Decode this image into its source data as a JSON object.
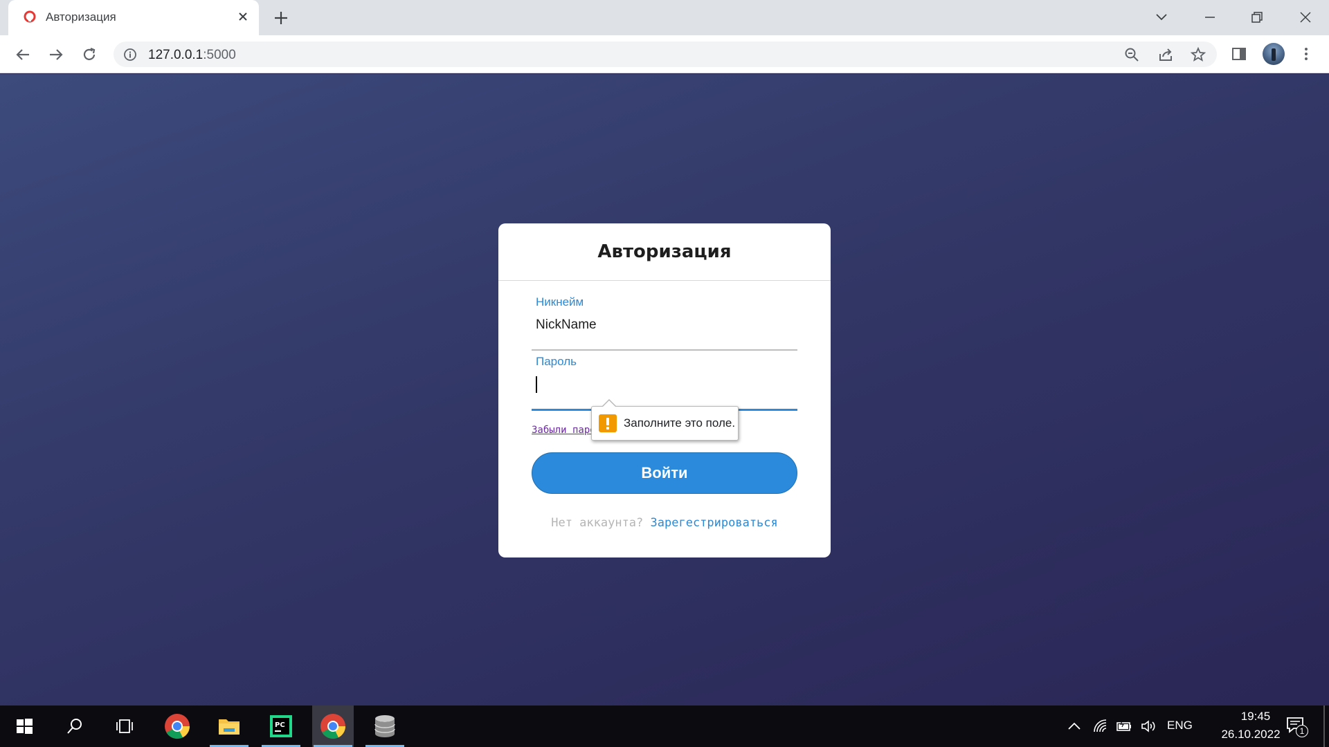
{
  "browser": {
    "tab_title": "Авторизация",
    "url_host": "127.0.0.1",
    "url_port": ":5000"
  },
  "colors": {
    "accent": "#2b8adc",
    "label": "#2a8ad8",
    "warning": "#f29900",
    "visited_link": "#6a2aa0"
  },
  "login": {
    "title": "Авторизация",
    "nickname_label": "Никнейм",
    "nickname_value": "NickName",
    "password_label": "Пароль",
    "password_value": "",
    "forgot_link": "Забыли пароль?",
    "submit_label": "Войти",
    "no_account_text": "Нет аккаунта?",
    "register_link": "Зарегестрироваться"
  },
  "validation": {
    "message": "Заполните это поле."
  },
  "taskbar": {
    "apps": [
      "windows-start-icon",
      "search-icon",
      "task-view-icon",
      "chrome-icon",
      "file-explorer-icon",
      "pycharm-icon",
      "chrome-icon",
      "database-icon"
    ],
    "language": "ENG",
    "time": "19:45",
    "date": "26.10.2022",
    "notification_count": "1"
  }
}
